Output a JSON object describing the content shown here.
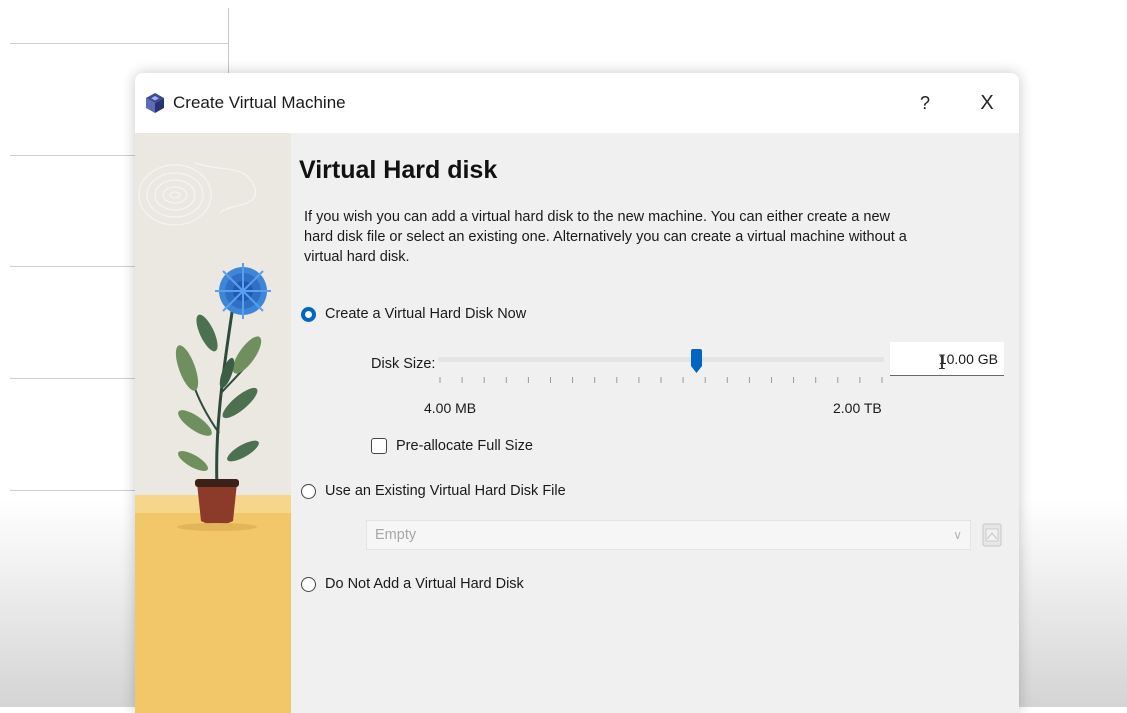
{
  "window": {
    "title": "Create Virtual Machine",
    "help_label": "?",
    "close_label": "X"
  },
  "page": {
    "heading": "Virtual Hard disk",
    "description": "If you wish you can add a virtual hard disk to the new machine. You can either create a new hard disk file or select an existing one. Alternatively you can create a virtual machine without a virtual hard disk."
  },
  "options": {
    "create_now": {
      "label": "Create a Virtual Hard Disk Now",
      "selected": true
    },
    "use_existing": {
      "label": "Use an Existing Virtual Hard Disk File",
      "selected": false
    },
    "do_not_add": {
      "label": "Do Not Add a Virtual Hard Disk",
      "selected": false
    }
  },
  "disk_size": {
    "label": "Disk Size:",
    "value": "10.00 GB",
    "min_label": "4.00 MB",
    "max_label": "2.00 TB",
    "slider_position": 0.58,
    "tick_count": 21
  },
  "preallocate": {
    "label": "Pre-allocate Full Size",
    "checked": false
  },
  "existing_file": {
    "value": "Empty"
  },
  "icons": {
    "app": "virtualbox-cube-icon",
    "browse": "folder-browse-icon",
    "dropdown": "chevron-down-icon"
  },
  "colors": {
    "accent": "#0067c0",
    "dialog_bg": "#f0f0f0",
    "titlebar_bg": "#ffffff",
    "illustration_floor": "#f2c76a"
  }
}
